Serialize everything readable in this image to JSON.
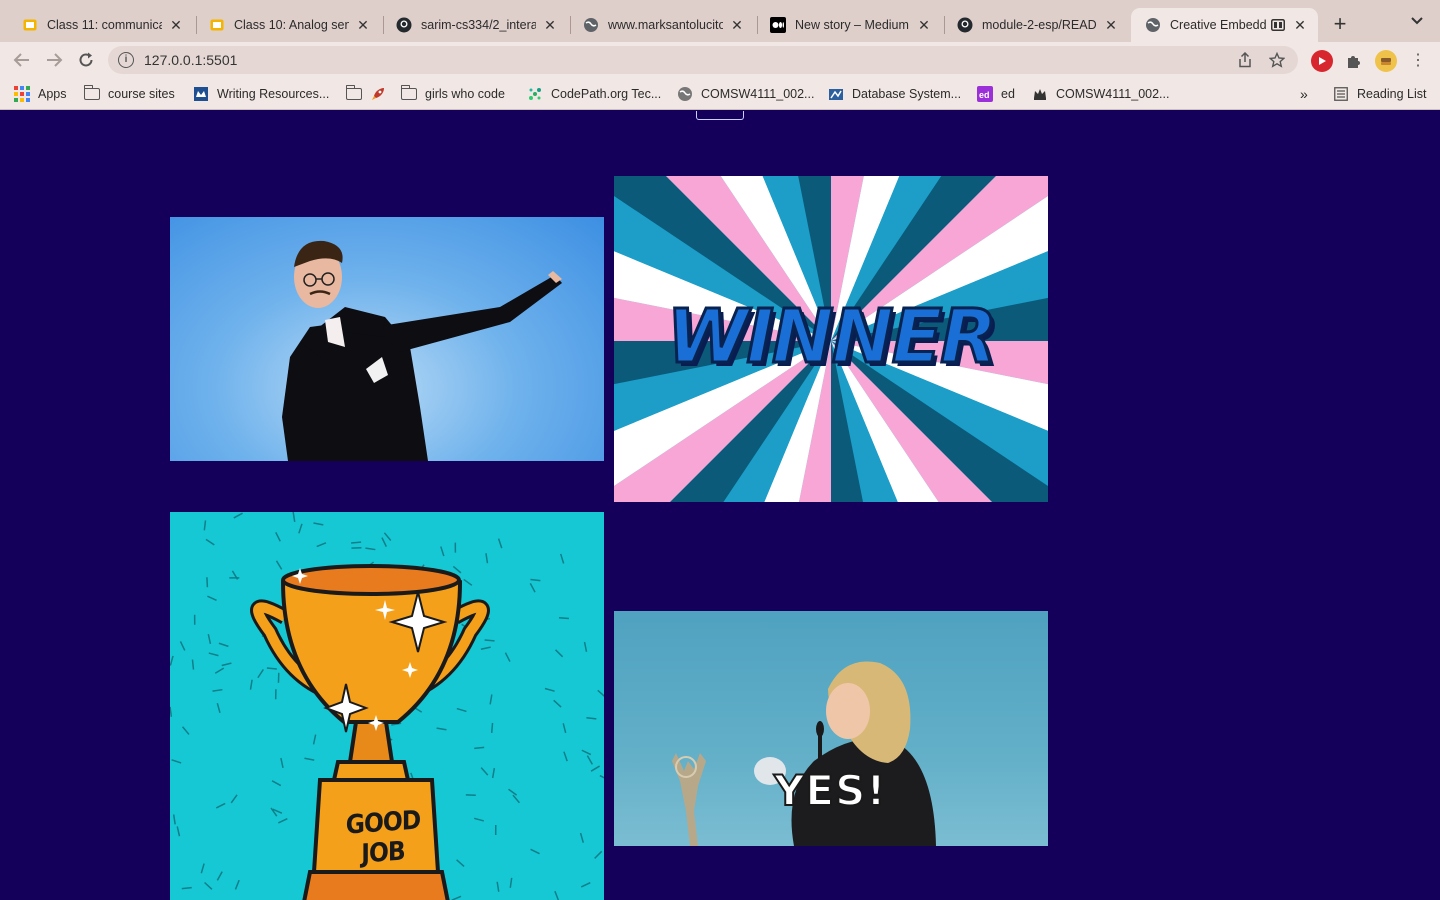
{
  "browser": {
    "tabs": [
      {
        "title": "Class 11: communicat",
        "icon": "slides-icon",
        "color": "#f4b400"
      },
      {
        "title": "Class 10: Analog sens",
        "icon": "slides-icon",
        "color": "#f4b400"
      },
      {
        "title": "sarim-cs334/2_intera",
        "icon": "github-icon",
        "color": "#24292e"
      },
      {
        "title": "www.marksantolucito",
        "icon": "globe-icon",
        "color": "#5f6368"
      },
      {
        "title": "New story – Medium",
        "icon": "medium-icon",
        "color": "#000000"
      },
      {
        "title": "module-2-esp/READM",
        "icon": "github-icon",
        "color": "#24292e"
      },
      {
        "title": "Creative Embedde",
        "icon": "globe-icon",
        "color": "#5f6368"
      }
    ],
    "active_tab_index": 6,
    "address": "127.0.0.1:5501",
    "bookmarks": [
      {
        "label": "Apps",
        "icon": "apps-grid-icon"
      },
      {
        "label": "course sites",
        "icon": "folder-icon"
      },
      {
        "label": "Writing Resources...",
        "icon": "columbia-icon"
      },
      {
        "label": "",
        "icon": "folder-icon"
      },
      {
        "label": "girls who code",
        "icon": "folder-icon"
      },
      {
        "label": "CodePath.org Tec...",
        "icon": "codepath-icon"
      },
      {
        "label": "COMSW4111_002...",
        "icon": "globe-icon"
      },
      {
        "label": "Database System...",
        "icon": "database-icon"
      },
      {
        "label": "ed",
        "icon": "ed-icon"
      },
      {
        "label": "COMSW4111_002...",
        "icon": "crown-icon"
      }
    ],
    "more_bookmarks": "»",
    "reading_list": "Reading List"
  },
  "page": {
    "background": "#14005a",
    "gifs": [
      {
        "name": "dab-gif",
        "caption": ""
      },
      {
        "name": "winner-gif",
        "caption": "WINNER"
      },
      {
        "name": "good-job-trophy-gif",
        "caption": "GOOD JOB"
      },
      {
        "name": "yes-gif",
        "caption": "YES!"
      }
    ]
  }
}
